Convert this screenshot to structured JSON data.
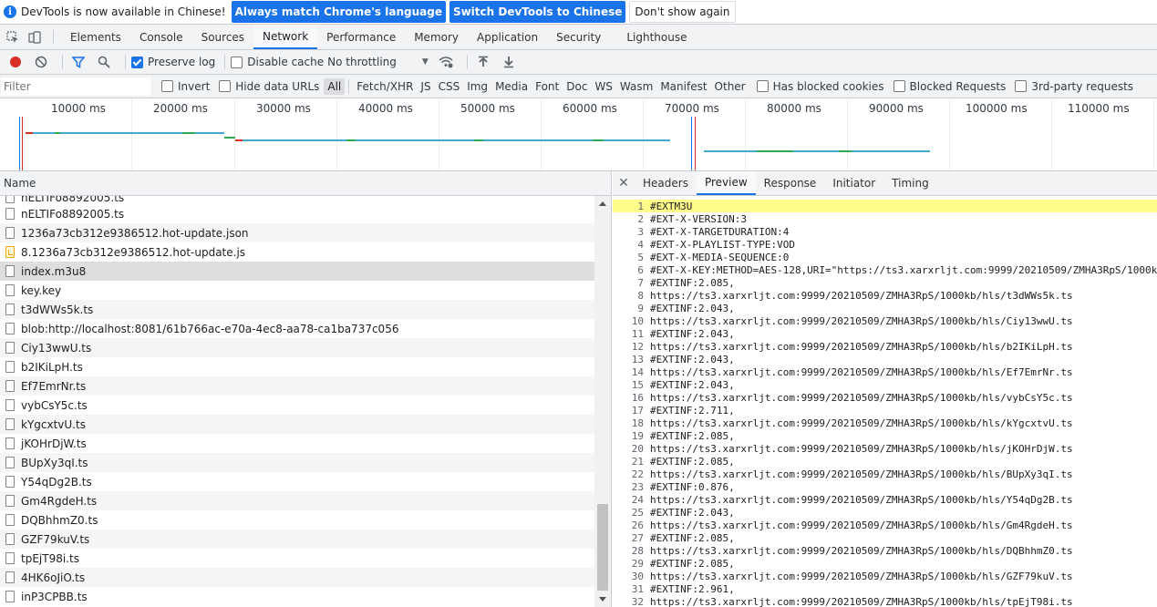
{
  "infobar": {
    "message": "DevTools is now available in Chinese!",
    "match_label": "Always match Chrome's language",
    "switch_label": "Switch DevTools to Chinese",
    "dismiss_label": "Don't show again"
  },
  "main_tabs": [
    "Elements",
    "Console",
    "Sources",
    "Network",
    "Performance",
    "Memory",
    "Application",
    "Security",
    "Lighthouse"
  ],
  "active_main_tab": "Network",
  "toolbar": {
    "preserve_log": "Preserve log",
    "disable_cache": "Disable cache",
    "throttling": "No throttling"
  },
  "filter": {
    "placeholder": "Filter",
    "invert": "Invert",
    "hide_data_urls": "Hide data URLs",
    "types": [
      "All",
      "Fetch/XHR",
      "JS",
      "CSS",
      "Img",
      "Media",
      "Font",
      "Doc",
      "WS",
      "Wasm",
      "Manifest",
      "Other"
    ],
    "has_blocked_cookies": "Has blocked cookies",
    "blocked_requests": "Blocked Requests",
    "third_party": "3rd-party requests"
  },
  "overview": {
    "ticks": [
      "10000 ms",
      "20000 ms",
      "30000 ms",
      "40000 ms",
      "50000 ms",
      "60000 ms",
      "70000 ms",
      "80000 ms",
      "90000 ms",
      "100000 ms",
      "110000 ms"
    ]
  },
  "requests": {
    "column_name": "Name",
    "items": [
      {
        "name": "nELTIFo8892005.ts",
        "icon": "file"
      },
      {
        "name": "1236a73cb312e9386512.hot-update.json",
        "icon": "file"
      },
      {
        "name": "8.1236a73cb312e9386512.hot-update.js",
        "icon": "js"
      },
      {
        "name": "index.m3u8",
        "icon": "file"
      },
      {
        "name": "key.key",
        "icon": "file"
      },
      {
        "name": "t3dWWs5k.ts",
        "icon": "file"
      },
      {
        "name": "blob:http://localhost:8081/61b766ac-e70a-4ec8-aa78-ca1ba737c056",
        "icon": "file"
      },
      {
        "name": "Ciy13wwU.ts",
        "icon": "file"
      },
      {
        "name": "b2IKiLpH.ts",
        "icon": "file"
      },
      {
        "name": "Ef7EmrNr.ts",
        "icon": "file"
      },
      {
        "name": "vybCsY5c.ts",
        "icon": "file"
      },
      {
        "name": "kYgcxtvU.ts",
        "icon": "file"
      },
      {
        "name": "jKOHrDjW.ts",
        "icon": "file"
      },
      {
        "name": "BUpXy3qI.ts",
        "icon": "file"
      },
      {
        "name": "Y54qDg2B.ts",
        "icon": "file"
      },
      {
        "name": "Gm4RgdeH.ts",
        "icon": "file"
      },
      {
        "name": "DQBhhmZ0.ts",
        "icon": "file"
      },
      {
        "name": "GZF79kuV.ts",
        "icon": "file"
      },
      {
        "name": "tpEjT98i.ts",
        "icon": "file"
      },
      {
        "name": "4HK6oJiO.ts",
        "icon": "file"
      },
      {
        "name": "inP3CPBB.ts",
        "icon": "file"
      }
    ],
    "selected": "index.m3u8"
  },
  "details": {
    "tabs": [
      "Headers",
      "Preview",
      "Response",
      "Initiator",
      "Timing"
    ],
    "active_tab": "Preview",
    "lines": [
      "#EXTM3U",
      "#EXT-X-VERSION:3",
      "#EXT-X-TARGETDURATION:4",
      "#EXT-X-PLAYLIST-TYPE:VOD",
      "#EXT-X-MEDIA-SEQUENCE:0",
      "#EXT-X-KEY:METHOD=AES-128,URI=\"https://ts3.xarxrljt.com:9999/20210509/ZMHA3RpS/1000k",
      "#EXTINF:2.085,",
      "https://ts3.xarxrljt.com:9999/20210509/ZMHA3RpS/1000kb/hls/t3dWWs5k.ts",
      "#EXTINF:2.043,",
      "https://ts3.xarxrljt.com:9999/20210509/ZMHA3RpS/1000kb/hls/Ciy13wwU.ts",
      "#EXTINF:2.043,",
      "https://ts3.xarxrljt.com:9999/20210509/ZMHA3RpS/1000kb/hls/b2IKiLpH.ts",
      "#EXTINF:2.043,",
      "https://ts3.xarxrljt.com:9999/20210509/ZMHA3RpS/1000kb/hls/Ef7EmrNr.ts",
      "#EXTINF:2.043,",
      "https://ts3.xarxrljt.com:9999/20210509/ZMHA3RpS/1000kb/hls/vybCsY5c.ts",
      "#EXTINF:2.711,",
      "https://ts3.xarxrljt.com:9999/20210509/ZMHA3RpS/1000kb/hls/kYgcxtvU.ts",
      "#EXTINF:2.085,",
      "https://ts3.xarxrljt.com:9999/20210509/ZMHA3RpS/1000kb/hls/jKOHrDjW.ts",
      "#EXTINF:2.085,",
      "https://ts3.xarxrljt.com:9999/20210509/ZMHA3RpS/1000kb/hls/BUpXy3qI.ts",
      "#EXTINF:0.876,",
      "https://ts3.xarxrljt.com:9999/20210509/ZMHA3RpS/1000kb/hls/Y54qDg2B.ts",
      "#EXTINF:2.043,",
      "https://ts3.xarxrljt.com:9999/20210509/ZMHA3RpS/1000kb/hls/Gm4RgdeH.ts",
      "#EXTINF:2.085,",
      "https://ts3.xarxrljt.com:9999/20210509/ZMHA3RpS/1000kb/hls/DQBhhmZ0.ts",
      "#EXTINF:2.085,",
      "https://ts3.xarxrljt.com:9999/20210509/ZMHA3RpS/1000kb/hls/GZF79kuV.ts",
      "#EXTINF:2.961,",
      "https://ts3.xarxrljt.com:9999/20210509/ZMHA3RpS/1000kb/hls/tpEjT98i.ts"
    ]
  },
  "colors": {
    "accent": "#1a73e8",
    "record": "#d93025",
    "highlight": "#fffc8a"
  }
}
